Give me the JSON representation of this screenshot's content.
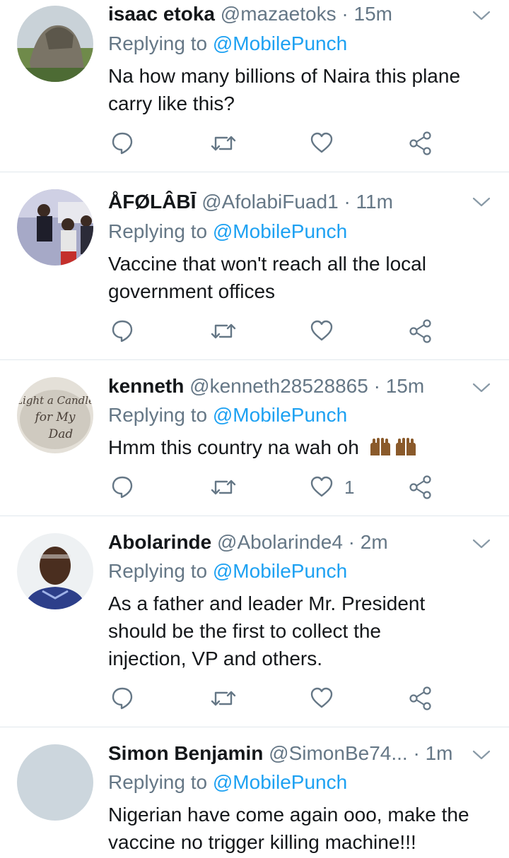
{
  "icons": {
    "reply": "reply-icon",
    "retweet": "retweet-icon",
    "like": "heart-icon",
    "share": "share-icon",
    "menu": "chevron-down-icon"
  },
  "colors": {
    "link": "#1da1f2",
    "secondary": "#657786",
    "text": "#14171a",
    "divider": "#e1e8ed"
  },
  "tweets": [
    {
      "name": "isaac etoka",
      "handle": "@mazaetoks",
      "separator": "·",
      "time": "15m",
      "replying_prefix": "Replying to",
      "replying_to": "@MobilePunch",
      "text_lines": [
        "Na how many billions of Naira this plane",
        "carry like this?"
      ],
      "likes": ""
    },
    {
      "name": "ÅFØLÂBĪ",
      "handle": "@AfolabiFuad1",
      "separator": "·",
      "time": "11m",
      "replying_prefix": "Replying to",
      "replying_to": "@MobilePunch",
      "text_lines": [
        "Vaccine that won't reach all the local",
        "government offices"
      ],
      "likes": ""
    },
    {
      "name": "kenneth",
      "handle": "@kenneth28528865",
      "separator": "·",
      "time": "15m",
      "replying_prefix": "Replying to",
      "replying_to": "@MobilePunch",
      "text_lines": [
        "Hmm this country na wah oh"
      ],
      "likes": "1",
      "avatar_text": [
        "Light a Candle",
        "for My",
        "Dad"
      ]
    },
    {
      "name": "Abolarinde",
      "handle": "@Abolarinde4",
      "separator": "·",
      "time": "2m",
      "replying_prefix": "Replying to",
      "replying_to": "@MobilePunch",
      "text_lines": [
        "As a father and leader Mr. President",
        "should be the first to collect the",
        "injection, VP and others."
      ],
      "likes": ""
    },
    {
      "name": "Simon Benjamin",
      "handle": "@SimonBe74...",
      "separator": "·",
      "time": "1m",
      "replying_prefix": "Replying to",
      "replying_to": "@MobilePunch",
      "text_lines": [
        "Nigerian have come again ooo, make the",
        "vaccine no trigger killing machine!!!"
      ],
      "likes": ""
    }
  ]
}
